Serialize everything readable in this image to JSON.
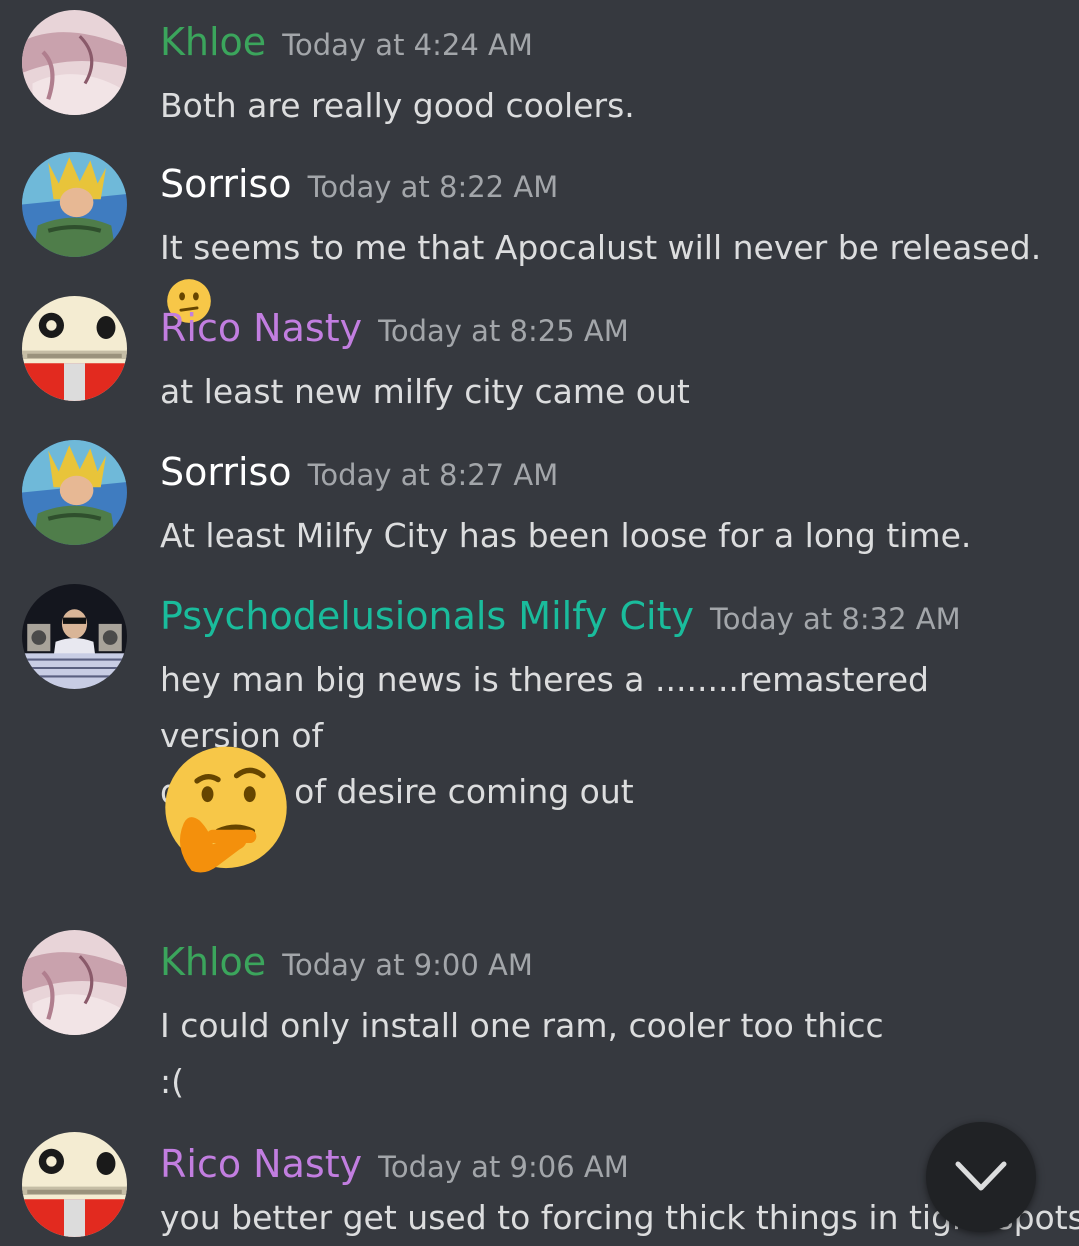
{
  "messages": [
    {
      "avatar": "khloe-avatar",
      "author": "Khloe",
      "author_color": "#3ba55c",
      "timestamp": "Today at 4:24 AM",
      "lines": [
        "Both are really good coolers."
      ]
    },
    {
      "avatar": "sorriso-avatar",
      "author": "Sorriso",
      "author_color": "#ffffff",
      "timestamp": "Today at 8:22 AM",
      "lines": [
        "It seems to me that Apocalust will never be released."
      ],
      "inline_emoji": "confused-face-emoji"
    },
    {
      "avatar": "rico-avatar",
      "author": "Rico Nasty",
      "author_color": "#c27ee0",
      "timestamp": "Today at 8:25 AM",
      "lines": [
        "at least new milfy city came out"
      ]
    },
    {
      "avatar": "sorriso-avatar",
      "author": "Sorriso",
      "author_color": "#ffffff",
      "timestamp": "Today at 8:27 AM",
      "lines": [
        "At least Milfy City has been loose for a long time."
      ]
    },
    {
      "avatar": "psycho-avatar",
      "author": "Psychodelusionals Milfy City",
      "author_color": "#1abc9c",
      "timestamp": "Today at 8:32 AM",
      "lines": [
        "hey man big news is theres a ........remastered version of",
        "dreams of desire coming out"
      ],
      "big_emoji": "thinking-face-emoji"
    },
    {
      "avatar": "khloe-avatar",
      "author": "Khloe",
      "author_color": "#3ba55c",
      "timestamp": "Today at 9:00 AM",
      "lines": [
        "I could only install one ram, cooler too thicc",
        ":("
      ]
    },
    {
      "avatar": "rico-avatar",
      "author": "Rico Nasty",
      "author_color": "#c27ee0",
      "timestamp": "Today at 9:06 AM",
      "lines": [
        "you better get used to forcing thick things in tight spots"
      ]
    }
  ],
  "scroll_button": {
    "icon": "chevron-down-icon"
  }
}
